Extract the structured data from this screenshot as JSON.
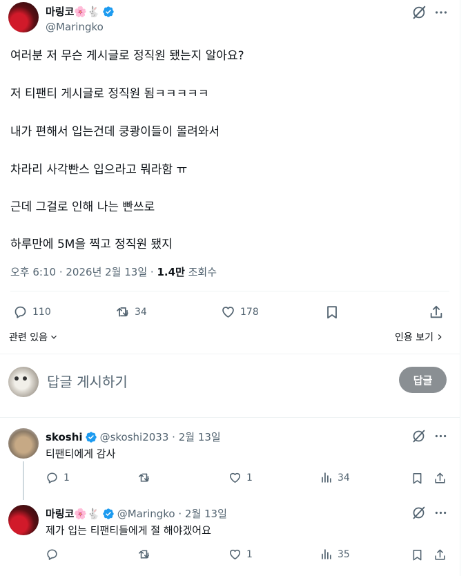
{
  "post": {
    "author_name": "마링코",
    "author_emojis": "🌸🐇",
    "author_handle": "@Maringko",
    "lines": [
      "여러분 저 무슨 게시글로 정직원 됐는지 알아요?",
      "저 티팬티 게시글로 정직원 됨ㅋㅋㅋㅋㅋ",
      "내가 편해서 입는건데 쿵쾅이들이 몰려와서",
      "차라리 사각빤스 입으라고 뭐라함 ㅠ",
      "근데 그걸로 인해 나는 빤쓰로",
      "하루만에 5M을 찍고  정직원 됐지"
    ],
    "time": "오후 6:10",
    "date": "2026년 2월 13일",
    "views_count": "1.4만",
    "views_label": "조회수",
    "stats": {
      "replies": "110",
      "reposts": "34",
      "likes": "178"
    },
    "related_label": "관련 있음",
    "quotes_label": "인용 보기"
  },
  "composer": {
    "placeholder": "답글 게시하기",
    "button_label": "답글"
  },
  "replies": [
    {
      "name": "skoshi",
      "emojis": "",
      "handle": "@skoshi2033",
      "date": "2월 13일",
      "text": "티팬티에게 감사",
      "replies": "1",
      "reposts": "",
      "likes": "1",
      "views": "34"
    },
    {
      "name": "마링코",
      "emojis": "🌸🐇",
      "handle": "@Maringko",
      "date": "2월 13일",
      "text": "제가 입는 티팬티들에게 절 해야겠어요",
      "replies": "",
      "reposts": "",
      "likes": "1",
      "views": "35"
    }
  ],
  "colors": {
    "verified": "#1d9bf0",
    "secondary_text": "#536471",
    "primary_text": "#0f1419",
    "reply_button": "#8a8f93"
  },
  "icons": [
    "grok-icon",
    "more-icon",
    "reply-icon",
    "repost-icon",
    "like-icon",
    "bookmark-icon",
    "share-icon",
    "views-icon",
    "verified-icon",
    "chevron-down-icon",
    "chevron-right-icon"
  ]
}
